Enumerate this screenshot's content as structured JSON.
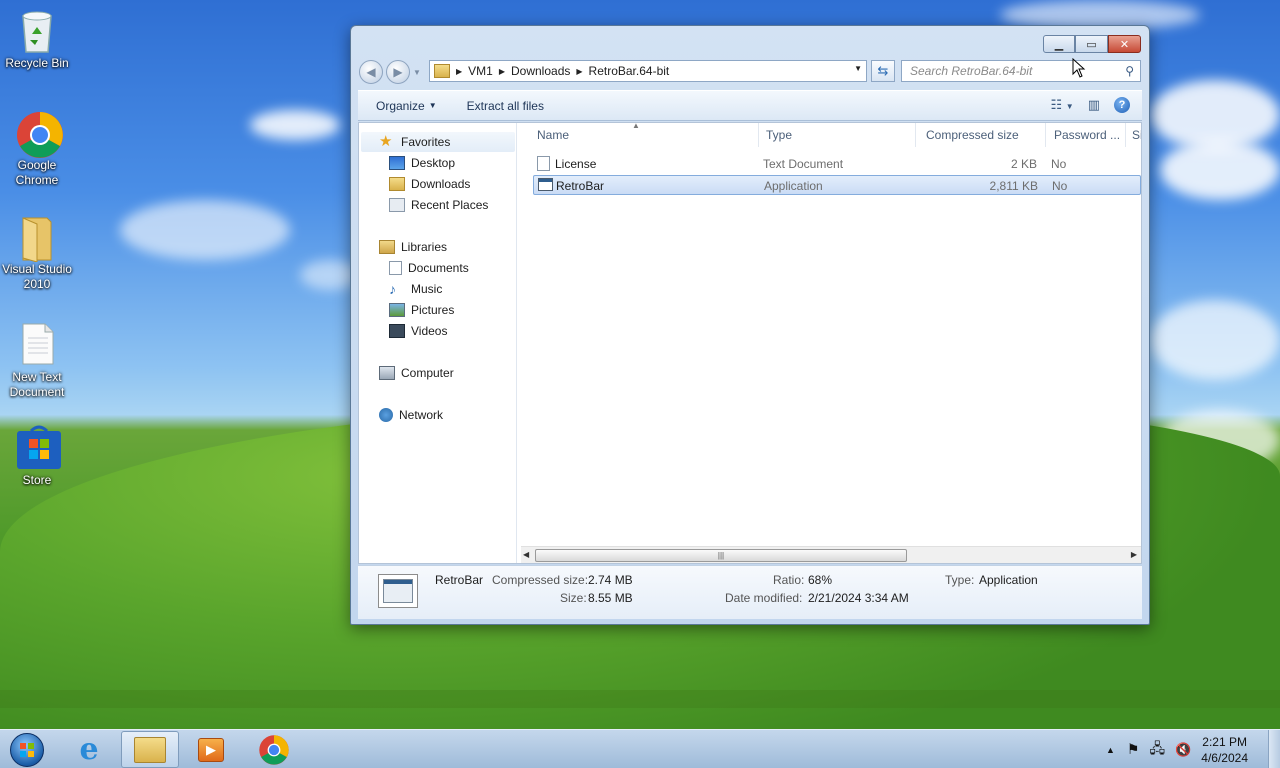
{
  "desktop": {
    "icons": [
      {
        "label": "Recycle Bin"
      },
      {
        "label": "Google Chrome"
      },
      {
        "label": "Visual Studio 2010"
      },
      {
        "label": "New Text Document"
      },
      {
        "label": "Store"
      }
    ]
  },
  "window": {
    "address": {
      "segments": [
        "VM1",
        "Downloads",
        "RetroBar.64-bit"
      ]
    },
    "search": {
      "placeholder": "Search RetroBar.64-bit"
    },
    "toolbar": {
      "organize": "Organize",
      "extract": "Extract all files"
    },
    "nav": {
      "favorites": "Favorites",
      "favorites_items": [
        "Desktop",
        "Downloads",
        "Recent Places"
      ],
      "libraries": "Libraries",
      "libraries_items": [
        "Documents",
        "Music",
        "Pictures",
        "Videos"
      ],
      "computer": "Computer",
      "network": "Network"
    },
    "columns": {
      "name": "Name",
      "type": "Type",
      "compressed": "Compressed size",
      "password": "Password ...",
      "size_trunc": "Si"
    },
    "files": [
      {
        "name": "License",
        "type": "Text Document",
        "compressed": "2 KB",
        "password": "No",
        "icon": "text-file-icon"
      },
      {
        "name": "RetroBar",
        "type": "Application",
        "compressed": "2,811 KB",
        "password": "No",
        "icon": "application-icon",
        "selected": true
      }
    ],
    "details": {
      "name": "RetroBar",
      "compressed_label": "Compressed size:",
      "compressed_value": "2.74 MB",
      "size_label": "Size:",
      "size_value": "8.55 MB",
      "ratio_label": "Ratio:",
      "ratio_value": "68%",
      "date_label": "Date modified:",
      "date_value": "2/21/2024 3:34 AM",
      "type_label": "Type:",
      "type_value": "Application"
    }
  },
  "taskbar": {
    "time": "2:21 PM",
    "date": "4/6/2024",
    "apps": [
      "start-orb",
      "internet-explorer-icon",
      "file-explorer-icon",
      "media-player-icon",
      "chrome-icon"
    ]
  },
  "colors": {
    "selection": "#cadcf5",
    "window_frame": "#c2d6ee",
    "close": "#c64a36"
  }
}
